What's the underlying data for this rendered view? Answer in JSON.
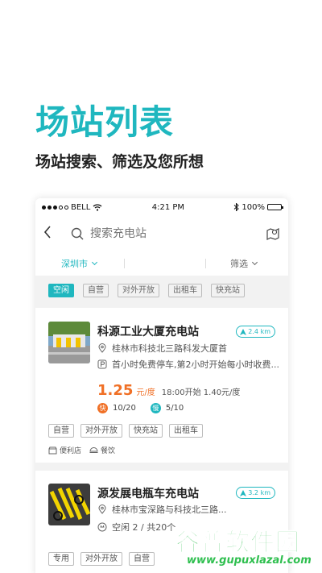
{
  "hero": {
    "title": "场站列表",
    "subtitle": "场站搜索、筛选及您所想"
  },
  "status": {
    "carrier": "BELL",
    "time": "4:21 PM",
    "battery": "100%"
  },
  "search": {
    "placeholder": "搜索充电站"
  },
  "filters": {
    "city": "深圳市",
    "screen": "筛选"
  },
  "tags": [
    "空闲",
    "自营",
    "对外开放",
    "出租车",
    "快充站"
  ],
  "stations": [
    {
      "name": "科源工业大厦充电站",
      "distance": "2.4 km",
      "address": "桂林市科技北三路科发大厦首",
      "parking": "首小时免费停车,第2小时开始每小时收费...",
      "price": "1.25",
      "price_unit": "元/度",
      "price_note": "18:00开始 1.40元/度",
      "fast_label": "快",
      "fast_count": "10/20",
      "slow_label": "慢",
      "slow_count": "5/10",
      "tags": [
        "自营",
        "对外开放",
        "快充站",
        "出租车"
      ],
      "amenities": [
        "便利店",
        "餐饮"
      ]
    },
    {
      "name": "源发展电瓶车充电站",
      "distance": "3.2 km",
      "address": "桂林市宝深路与科技北三路...",
      "availability": "空闲 2 / 共20个",
      "tags": [
        "专用",
        "对外开放",
        "自营"
      ]
    }
  ],
  "watermark": {
    "text": "谷普软件园",
    "url": "www.gupuxlazal.com"
  },
  "colors": {
    "accent": "#1fb7bf",
    "price": "#f07026",
    "watermark": "#2fbf4f"
  }
}
